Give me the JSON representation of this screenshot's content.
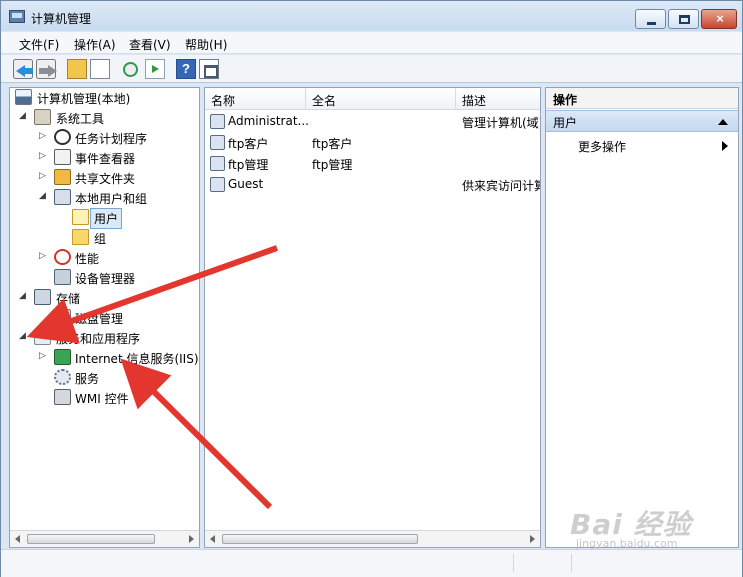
{
  "window": {
    "title": "计算机管理"
  },
  "menu": [
    "文件(F)",
    "操作(A)",
    "查看(V)",
    "帮助(H)"
  ],
  "toolbar": {
    "help_label": "?"
  },
  "tree": [
    {
      "label": "计算机管理(本地)",
      "expander": "",
      "icon": "computer-icon"
    },
    {
      "label": "系统工具",
      "expander": "◢",
      "icon": "tools-icon"
    },
    {
      "label": "任务计划程序",
      "expander": "▷",
      "icon": "clock-icon"
    },
    {
      "label": "事件查看器",
      "expander": "▷",
      "icon": "event-viewer-icon"
    },
    {
      "label": "共享文件夹",
      "expander": "▷",
      "icon": "shared-folder-icon"
    },
    {
      "label": "本地用户和组",
      "expander": "◢",
      "icon": "users-groups-icon"
    },
    {
      "label": "用户",
      "expander": "",
      "icon": "folder-open-icon"
    },
    {
      "label": "组",
      "expander": "",
      "icon": "folder-icon"
    },
    {
      "label": "性能",
      "expander": "▷",
      "icon": "performance-icon"
    },
    {
      "label": "设备管理器",
      "expander": "",
      "icon": "device-manager-icon"
    },
    {
      "label": "存储",
      "expander": "◢",
      "icon": "storage-icon"
    },
    {
      "label": "磁盘管理",
      "expander": "",
      "icon": "disk-icon"
    },
    {
      "label": "服务和应用程序",
      "expander": "◢",
      "icon": "services-apps-icon"
    },
    {
      "label": "Internet 信息服务(IIS)管",
      "expander": "▷",
      "icon": "iis-icon"
    },
    {
      "label": "服务",
      "expander": "",
      "icon": "gear-icon"
    },
    {
      "label": "WMI 控件",
      "expander": "",
      "icon": "wmi-icon"
    }
  ],
  "list": {
    "columns": [
      "名称",
      "全名",
      "描述"
    ],
    "rows": [
      {
        "name": "Administrat...",
        "fullname": "",
        "description": "管理计算机(域)"
      },
      {
        "name": "ftp客户",
        "fullname": "ftp客户",
        "description": ""
      },
      {
        "name": "ftp管理",
        "fullname": "ftp管理",
        "description": ""
      },
      {
        "name": "Guest",
        "fullname": "",
        "description": "供来宾访问计算"
      }
    ]
  },
  "actions": {
    "title": "操作",
    "group": "用户",
    "items": [
      "更多操作"
    ]
  },
  "watermark": {
    "main": "Bai 经验",
    "sub": "jingyan.baidu.com"
  },
  "colors": {
    "arrow": "#e3362f",
    "selection": "#dbeaf9",
    "window": "#dbe7f4"
  }
}
